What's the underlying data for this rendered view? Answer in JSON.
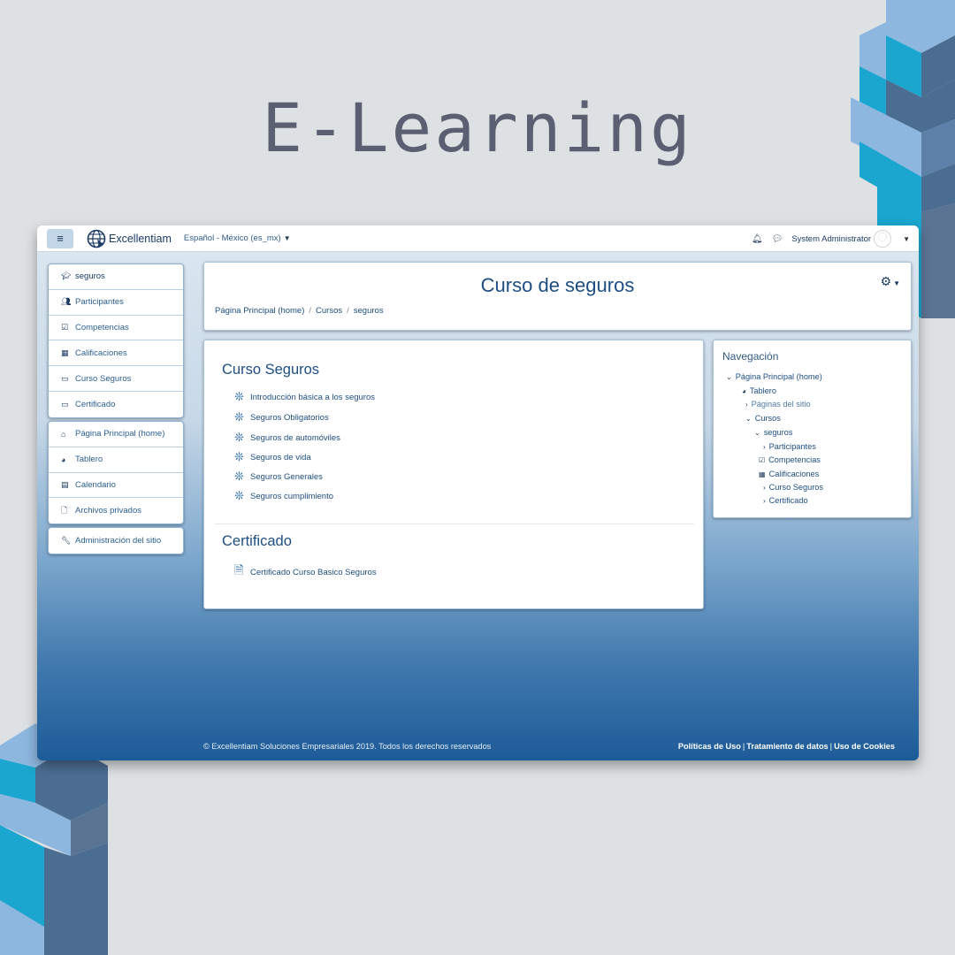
{
  "hero": {
    "title": "E-Learning"
  },
  "topbar": {
    "brand": "Excellentiam",
    "language": "Español - México (es_mx)",
    "user": "System Administrator"
  },
  "sidebar": {
    "course_items": [
      {
        "label": "seguros",
        "icon": "graduation-cap-icon"
      },
      {
        "label": "Participantes",
        "icon": "users-icon"
      },
      {
        "label": "Competencias",
        "icon": "checkbox-icon"
      },
      {
        "label": "Calificaciones",
        "icon": "table-icon"
      },
      {
        "label": "Curso Seguros",
        "icon": "folder-icon"
      },
      {
        "label": "Certificado",
        "icon": "folder-icon"
      }
    ],
    "site_items": [
      {
        "label": "Página Principal (home)",
        "icon": "home-icon"
      },
      {
        "label": "Tablero",
        "icon": "dashboard-icon"
      },
      {
        "label": "Calendario",
        "icon": "calendar-icon"
      },
      {
        "label": "Archivos privados",
        "icon": "file-icon"
      }
    ],
    "admin_items": [
      {
        "label": "Administración del sitio",
        "icon": "wrench-icon"
      }
    ]
  },
  "header": {
    "title": "Curso de seguros",
    "breadcrumb": [
      "Página Principal (home)",
      "Cursos",
      "seguros"
    ]
  },
  "content": {
    "sections": [
      {
        "title": "Curso Seguros",
        "activities": [
          "Introducción básica a los seguros",
          "Seguros Obligatorios",
          "Seguros de automóviles",
          "Seguros de vida",
          "Seguros Generales",
          "Seguros cumplimiento"
        ]
      },
      {
        "title": "Certificado",
        "activities": [
          "Certificado Curso Basico Seguros"
        ]
      }
    ]
  },
  "navigation": {
    "title": "Navegación",
    "items": [
      {
        "label": "Página Principal (home)",
        "icon": "chevron-down-icon"
      },
      {
        "label": "Tablero",
        "icon": "dashboard-icon"
      },
      {
        "label": "Páginas del sitio",
        "icon": "chevron-right-icon"
      },
      {
        "label": "Cursos",
        "icon": "chevron-down-icon"
      },
      {
        "label": "seguros",
        "icon": "chevron-down-icon"
      },
      {
        "label": "Participantes",
        "icon": "chevron-right-icon"
      },
      {
        "label": "Competencias",
        "icon": "checkbox-icon"
      },
      {
        "label": "Calificaciones",
        "icon": "table-icon"
      },
      {
        "label": "Curso Seguros",
        "icon": "chevron-right-icon"
      },
      {
        "label": "Certificado",
        "icon": "chevron-right-icon"
      }
    ]
  },
  "footer": {
    "copyright": "© Excellentiam Soluciones Empresariales 2019. Todos los derechos reservados",
    "links": [
      "Políticas de Uso",
      "Tratamiento de datos",
      "Uso de Cookies"
    ]
  }
}
